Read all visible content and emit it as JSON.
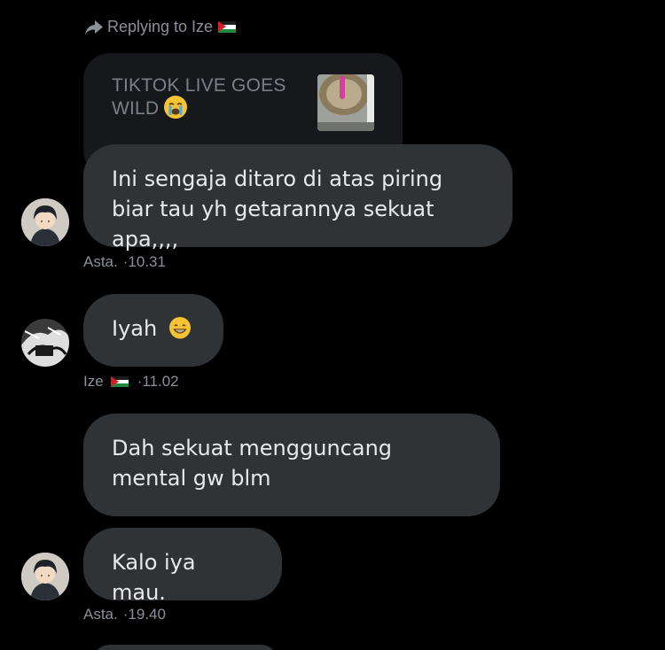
{
  "reply_header": {
    "label": "Replying to Ize"
  },
  "quoted_message": {
    "text": "TIKTOK LIVE GOES WILD"
  },
  "messages": [
    {
      "text": "Ini sengaja ditaro di atas piring biar tau yh getarannya sekuat apa,,,,",
      "sender": "Asta.",
      "time": "·10.31"
    },
    {
      "text": "Iyah",
      "sender": "Ize",
      "time": "·11.02"
    },
    {
      "text": "Dah sekuat mengguncang mental gw blm"
    },
    {
      "text": "Kalo iya mau.",
      "sender": "Asta.",
      "time": "·19.40"
    }
  ],
  "icons": {
    "reply": "reply-arrow-icon",
    "flag": "palestine-flag-icon",
    "crying_emoji": "loudly-crying-face-emoji",
    "grin_emoji": "grinning-face-emoji"
  },
  "colors": {
    "background": "#000000",
    "bubble": "#2f3336",
    "quote_bubble": "#16181c",
    "text": "#e7e9ea",
    "muted": "#8b9196"
  }
}
